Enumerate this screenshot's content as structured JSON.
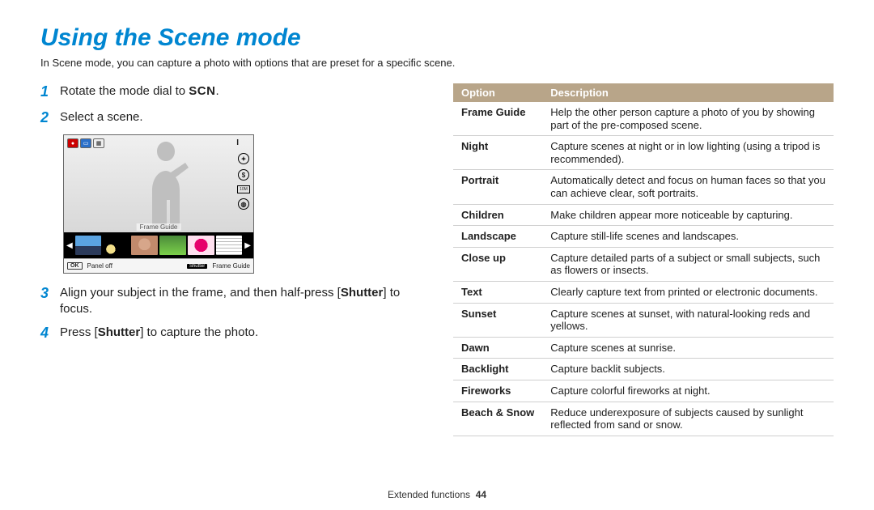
{
  "title": "Using the Scene mode",
  "intro": "In Scene mode, you can capture a photo with options that are preset for a specific scene.",
  "steps": {
    "s1_pre": "Rotate the mode dial to ",
    "s1_scn": "SCN",
    "s1_post": ".",
    "s2": "Select a scene.",
    "s3_pre": "Align your subject in the frame, and then half-press [",
    "s3_bold": "Shutter",
    "s3_post": "] to focus.",
    "s4_pre": "Press [",
    "s4_bold": "Shutter",
    "s4_post": "] to capture the photo."
  },
  "lcd": {
    "top_right_indicator": "I",
    "frame_guide_label": "Frame Guide",
    "bottom_ok": "OK",
    "bottom_panel_off": "Panel off",
    "bottom_shutter": "Shutter",
    "bottom_frame_guide": "Frame Guide",
    "right_icons": {
      "flash": "⚡",
      "size": "10M"
    }
  },
  "table": {
    "headers": {
      "option": "Option",
      "description": "Description"
    },
    "rows": [
      {
        "option": "Frame Guide",
        "desc": "Help the other person capture a photo of you by showing part of the pre-composed scene."
      },
      {
        "option": "Night",
        "desc": "Capture scenes at night or in low lighting (using a tripod is recommended)."
      },
      {
        "option": "Portrait",
        "desc": "Automatically detect and focus on human faces so that you can achieve clear, soft portraits."
      },
      {
        "option": "Children",
        "desc": "Make children appear more noticeable by capturing."
      },
      {
        "option": "Landscape",
        "desc": "Capture still-life scenes and landscapes."
      },
      {
        "option": "Close up",
        "desc": "Capture detailed parts of a subject or small subjects, such as flowers or insects."
      },
      {
        "option": "Text",
        "desc": "Clearly capture text from printed or electronic documents."
      },
      {
        "option": "Sunset",
        "desc": "Capture scenes at sunset, with natural-looking reds and yellows."
      },
      {
        "option": "Dawn",
        "desc": "Capture scenes at sunrise."
      },
      {
        "option": "Backlight",
        "desc": "Capture backlit subjects."
      },
      {
        "option": "Fireworks",
        "desc": "Capture colorful fireworks at night."
      },
      {
        "option": "Beach & Snow",
        "desc": "Reduce underexposure of subjects caused by sunlight reflected from sand or snow."
      }
    ]
  },
  "footer": {
    "label": "Extended functions",
    "page": "44"
  }
}
